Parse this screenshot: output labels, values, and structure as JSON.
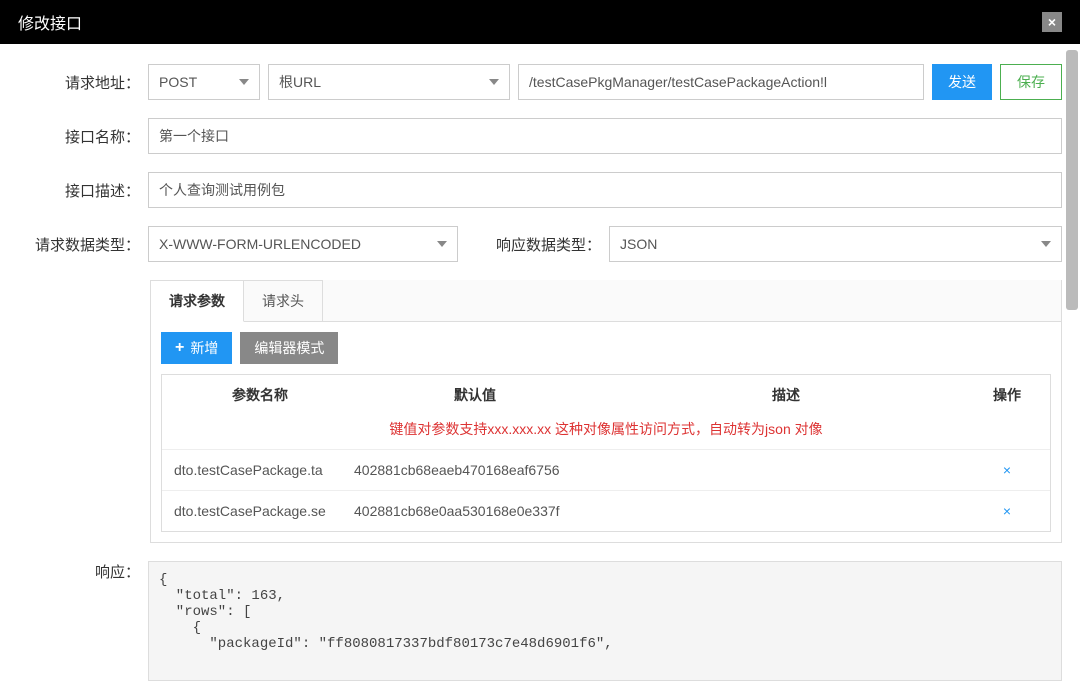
{
  "header": {
    "title": "修改接口"
  },
  "labels": {
    "request_url": "请求地址：",
    "api_name": "接口名称：",
    "api_desc": "接口描述：",
    "req_data_type": "请求数据类型：",
    "resp_data_type": "响应数据类型：",
    "response": "响应："
  },
  "form": {
    "method": "POST",
    "root_url": "根URL",
    "path": "/testCasePkgManager/testCasePackageAction!l",
    "api_name_value": "第一个接口",
    "api_desc_value": "个人查询测试用例包",
    "req_data_type_value": "X-WWW-FORM-URLENCODED",
    "resp_data_type_value": "JSON"
  },
  "buttons": {
    "send": "发送",
    "save": "保存",
    "add": "新增",
    "editor_mode": "编辑器模式"
  },
  "tabs": {
    "request_params": "请求参数",
    "request_headers": "请求头"
  },
  "param_table": {
    "headers": {
      "name": "参数名称",
      "default": "默认值",
      "desc": "描述",
      "op": "操作"
    },
    "hint": "键值对参数支持xxx.xxx.xx 这种对像属性访问方式，自动转为json 对像",
    "rows": [
      {
        "name": "dto.testCasePackage.ta",
        "default": "402881cb68eaeb470168eaf6756",
        "desc": "",
        "op": "×"
      },
      {
        "name": "dto.testCasePackage.se",
        "default": "402881cb68e0aa530168e0e337f",
        "desc": "",
        "op": "×"
      }
    ]
  },
  "response_body": "{\n  \"total\": 163,\n  \"rows\": [\n    {\n      \"packageId\": \"ff8080817337bdf80173c7e48d6901f6\","
}
